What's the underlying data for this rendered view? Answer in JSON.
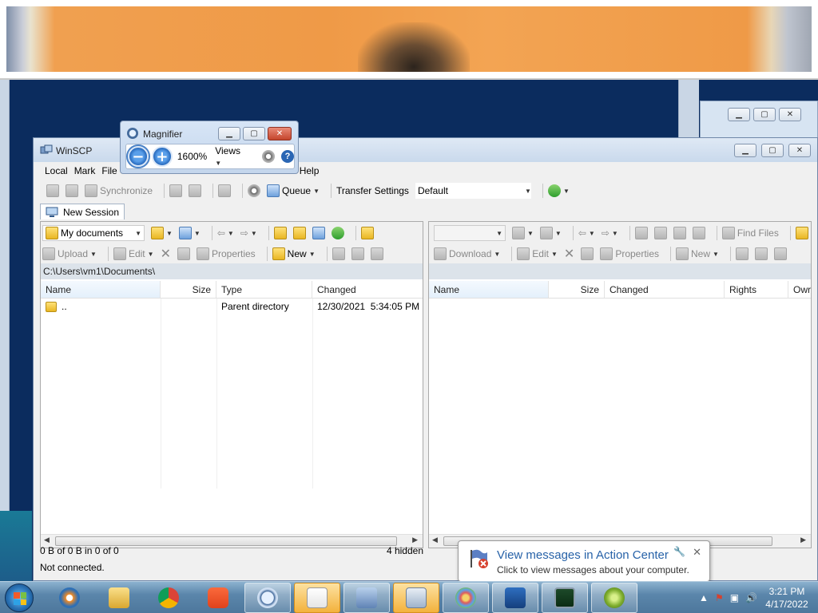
{
  "winscp": {
    "title": "WinSCP",
    "menu": [
      "Local",
      "Mark",
      "File",
      "Help"
    ],
    "toolbar": {
      "synchronize": "Synchronize",
      "queue": "Queue",
      "transfer_settings_label": "Transfer Settings",
      "transfer_settings_value": "Default"
    },
    "tab_new_session": "New Session",
    "local": {
      "location": "My documents",
      "upload": "Upload",
      "edit": "Edit",
      "properties": "Properties",
      "new": "New",
      "path": "C:\\Users\\vm1\\Documents\\",
      "columns": [
        "Name",
        "Size",
        "Type",
        "Changed"
      ],
      "rows": [
        {
          "name": "..",
          "size": "",
          "type": "Parent directory",
          "changed": "12/30/2021  5:34:05 PM"
        }
      ]
    },
    "remote": {
      "find_files": "Find Files",
      "download": "Download",
      "edit": "Edit",
      "properties": "Properties",
      "new": "New",
      "columns": [
        "Name",
        "Size",
        "Changed",
        "Rights",
        "Owr"
      ]
    },
    "status": {
      "selection": "0 B of 0 B in 0 of 0",
      "hidden": "4 hidden",
      "connection": "Not connected."
    }
  },
  "magnifier": {
    "title": "Magnifier",
    "zoom": "1600%",
    "views": "Views"
  },
  "action_center": {
    "title": "View messages in Action Center",
    "text": "Click to view messages about your computer."
  },
  "taskbar": {
    "time": "3:21 PM",
    "date": "4/17/2022"
  },
  "colors": {
    "desktop": "#0b2c5e",
    "accent": "#2762a8",
    "taskbar": "#5b86ab"
  }
}
